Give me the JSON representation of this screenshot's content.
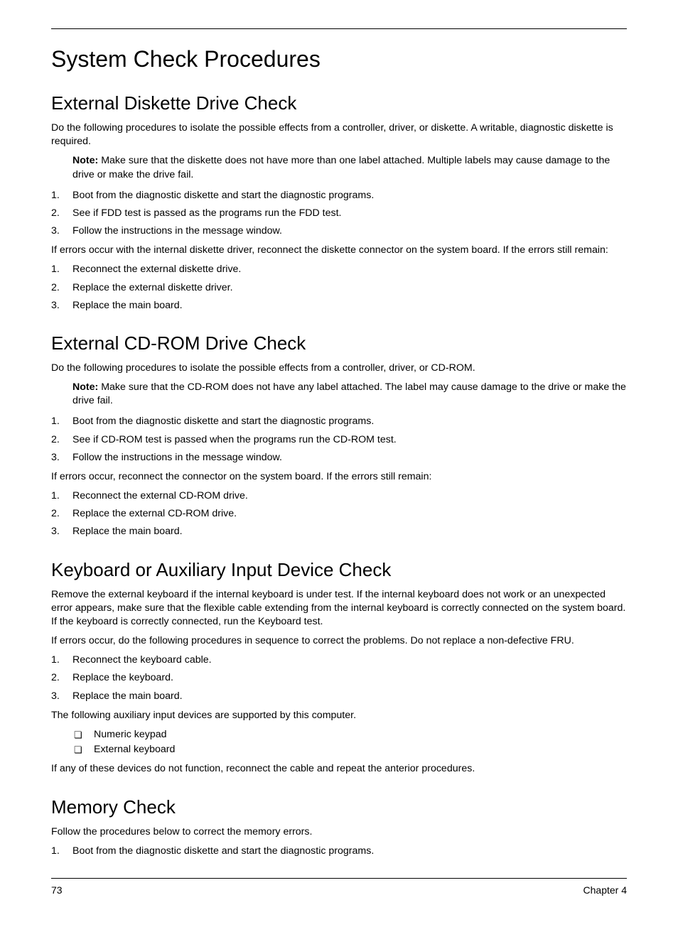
{
  "page": {
    "title": "System Check Procedures",
    "number": "73",
    "chapter": "Chapter 4"
  },
  "sections": {
    "diskette": {
      "heading": "External Diskette Drive Check",
      "intro": "Do the following procedures to isolate the possible effects from a controller, driver, or diskette. A writable, diagnostic diskette is required.",
      "note_label": "Note:",
      "note": " Make sure that the diskette does not have more than one label attached. Multiple labels may cause damage to the drive or make the drive fail.",
      "steps1": [
        "Boot from the diagnostic diskette and start the diagnostic programs.",
        "See if FDD test is passed as the programs run the FDD test.",
        "Follow the instructions in the message window."
      ],
      "mid": "If errors occur with the internal diskette driver, reconnect the diskette connector on the system board. If the errors still remain:",
      "steps2": [
        "Reconnect the external diskette drive.",
        "Replace the external diskette driver.",
        "Replace the main board."
      ]
    },
    "cdrom": {
      "heading": "External CD-ROM Drive Check",
      "intro": "Do the following procedures to isolate the possible effects from a controller, driver, or CD-ROM.",
      "note_label": "Note:",
      "note": " Make sure that the CD-ROM does not have any label attached. The label may cause damage to the drive or make the drive fail.",
      "steps1": [
        "Boot from the diagnostic diskette and start the diagnostic programs.",
        "See if CD-ROM test is passed when the programs run the CD-ROM test.",
        "Follow the instructions in the message window."
      ],
      "mid": "If errors occur, reconnect the connector on the system board. If the errors still remain:",
      "steps2": [
        "Reconnect the external CD-ROM drive.",
        "Replace the external CD-ROM drive.",
        "Replace the main board."
      ]
    },
    "keyboard": {
      "heading": "Keyboard or Auxiliary Input Device Check",
      "intro1": "Remove the external keyboard if the internal keyboard is under test. If the internal keyboard does not work or an unexpected error appears, make sure that the flexible cable extending from the internal keyboard is correctly connected on the system board. If the keyboard is correctly connected, run the Keyboard test.",
      "intro2": "If errors occur, do the following procedures in sequence to correct the problems. Do not replace a non-defective FRU.",
      "steps1": [
        "Reconnect the keyboard cable.",
        "Replace the keyboard.",
        "Replace the main board."
      ],
      "mid": "The following auxiliary input devices are supported by this computer.",
      "bullets": [
        "Numeric keypad",
        "External keyboard"
      ],
      "outro": "If any of these devices do not function, reconnect the cable and repeat the anterior procedures."
    },
    "memory": {
      "heading": "Memory Check",
      "intro": "Follow the procedures below to correct the memory errors.",
      "steps1": [
        "Boot from the diagnostic diskette and start the diagnostic programs."
      ]
    }
  }
}
